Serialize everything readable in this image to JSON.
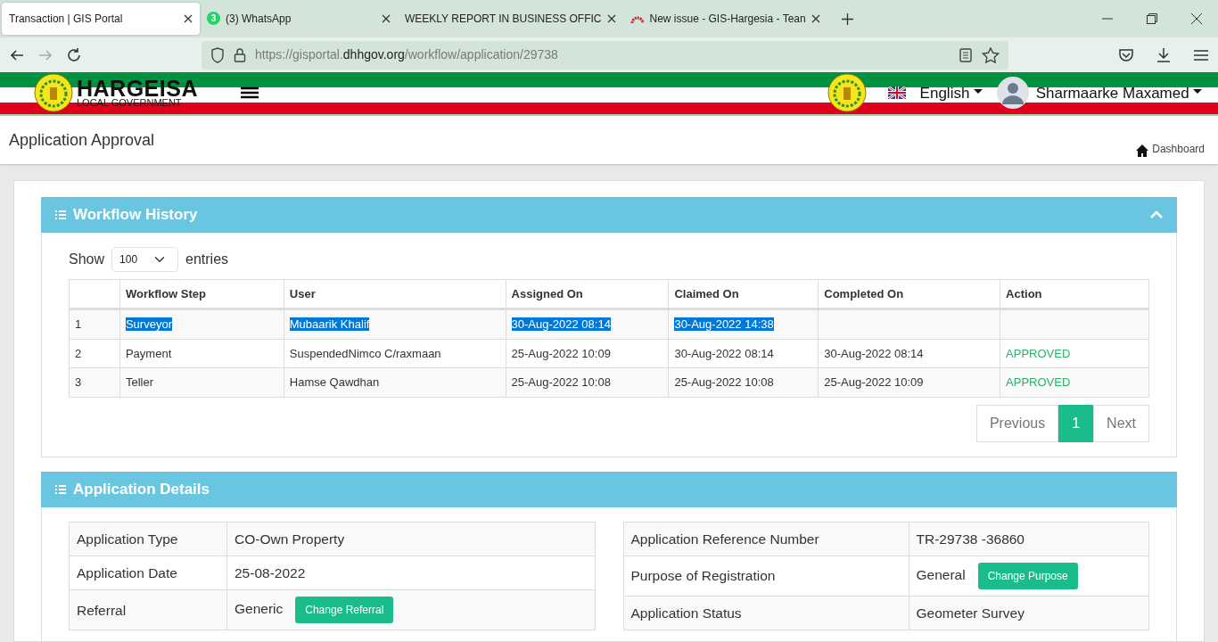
{
  "browser": {
    "tabs": [
      {
        "title": "Transaction | GIS Portal",
        "selected": true,
        "kind": "plain"
      },
      {
        "title": "(3) WhatsApp",
        "selected": false,
        "kind": "chat",
        "badge": "3"
      },
      {
        "title": "WEEKLY REPORT IN BUSINESS OFFIC",
        "selected": false,
        "kind": "plain"
      },
      {
        "title": "New issue - GIS-Hargesia - Tean",
        "selected": false,
        "kind": "gauge"
      }
    ],
    "url": {
      "prefix": "https://gisportal.",
      "domain": "dhhgov.org",
      "path": "/workflow/application/29738"
    }
  },
  "header": {
    "brand": "HARGEISA",
    "brand_sub": "LOCAL GOVERNMENT",
    "language": "English",
    "user": "Sharmaarke Maxamed"
  },
  "page": {
    "title": "Application Approval",
    "breadcrumb": "Dashboard"
  },
  "workflow": {
    "title": "Workflow History",
    "expanded": true,
    "show_label": "Show",
    "page_size": "100",
    "entries_label": "entries",
    "columns": [
      "Workflow Step",
      "User",
      "Assigned On",
      "Claimed On",
      "Completed On",
      "Action"
    ],
    "rows": [
      {
        "number": "1",
        "cells": [
          "Surveyor",
          "Mubaarik Khalif",
          "30-Aug-2022 08:14",
          "30-Aug-2022 14:38",
          null,
          null
        ],
        "text_selected": true
      },
      {
        "number": "2",
        "cells": [
          "Payment",
          "SuspendedNimco C/raxmaan",
          "25-Aug-2022 10:09",
          "30-Aug-2022 08:14",
          "30-Aug-2022 08:14",
          "APPROVED"
        ],
        "text_selected": false
      },
      {
        "number": "3",
        "cells": [
          "Teller",
          "Hamse Qawdhan",
          "25-Aug-2022 10:08",
          "25-Aug-2022 10:08",
          "25-Aug-2022 10:09",
          "APPROVED"
        ],
        "text_selected": false
      }
    ],
    "pagination": {
      "previous": "Previous",
      "pages": [
        {
          "label": "1",
          "selected": true
        }
      ],
      "next": "Next"
    }
  },
  "details": {
    "title": "Application Details",
    "left": [
      {
        "label": "Application Type",
        "value": "CO-Own Property"
      },
      {
        "label": "Application Date",
        "value": "25-08-2022"
      },
      {
        "label": "Referral",
        "value": "Generic",
        "button": "Change Referral"
      }
    ],
    "right": [
      {
        "label": "Application Reference Number",
        "value": "TR-29738 -36860"
      },
      {
        "label": "Purpose of Registration",
        "value": "General",
        "button": "Change Purpose"
      },
      {
        "label": "Application Status",
        "value": "Geometer Survey"
      }
    ]
  }
}
